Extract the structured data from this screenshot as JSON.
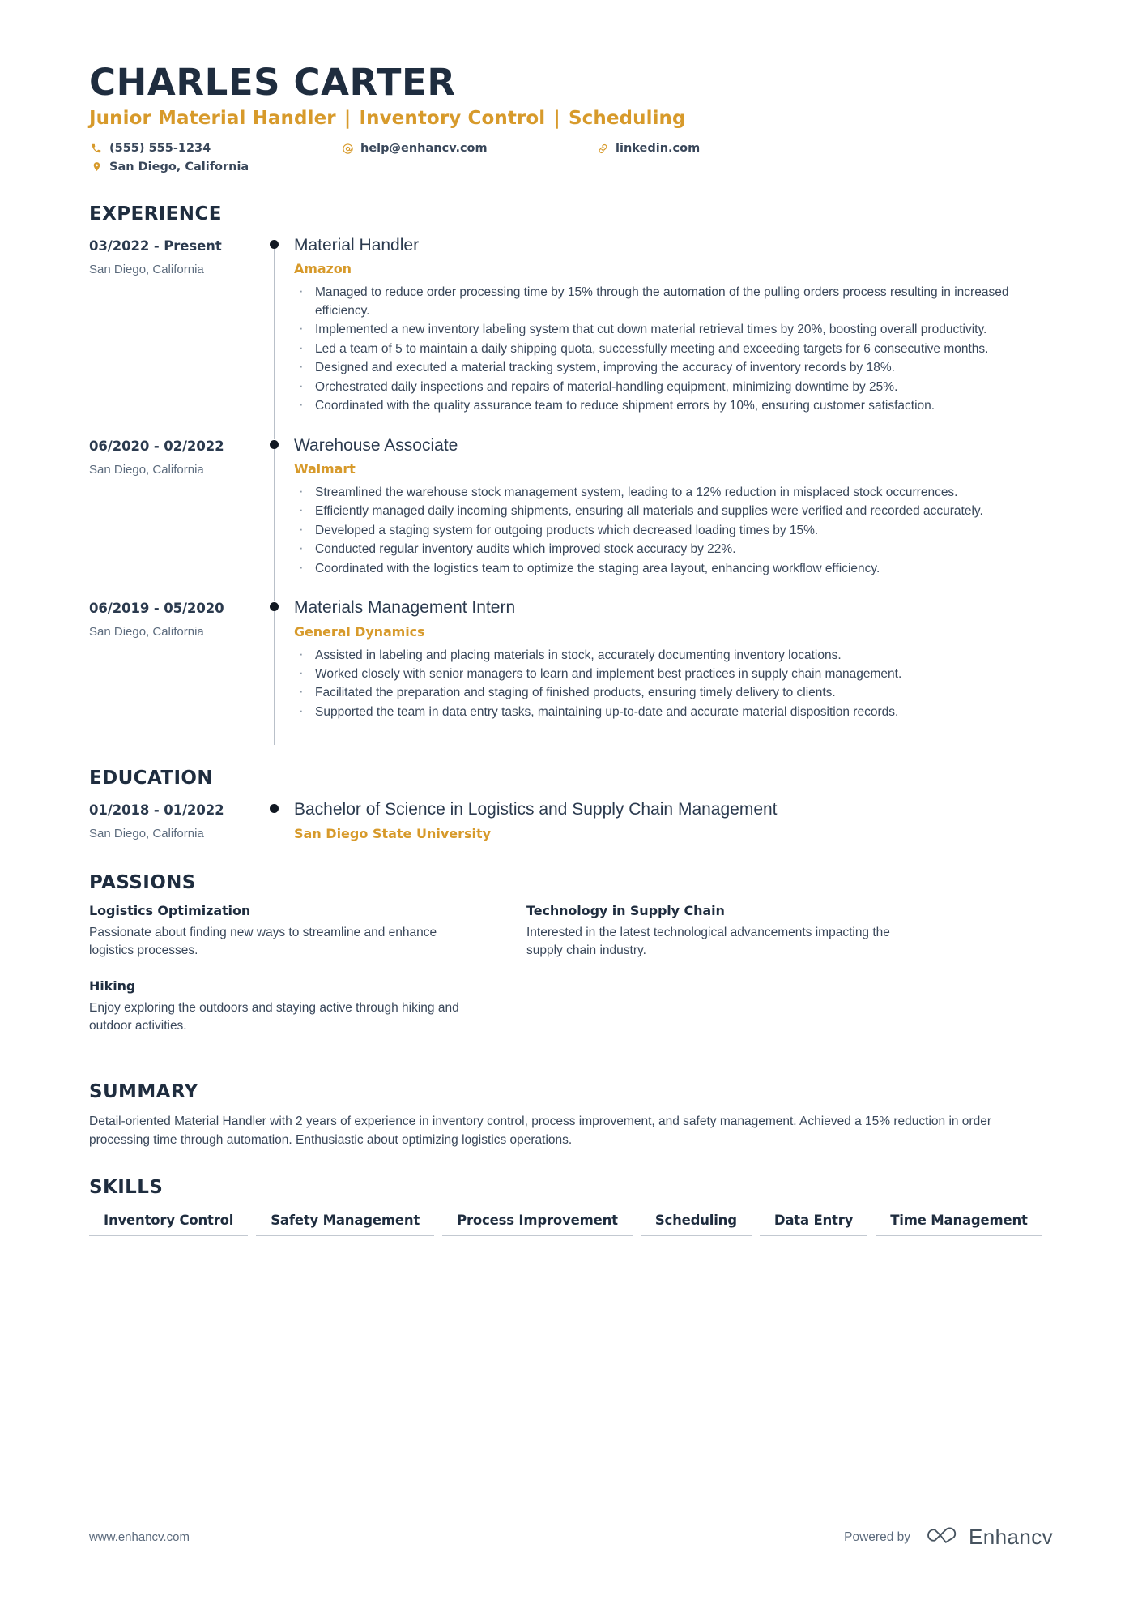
{
  "header": {
    "name": "CHARLES CARTER",
    "headline_parts": [
      "Junior Material Handler",
      "Inventory Control",
      "Scheduling"
    ],
    "headline": "Junior Material Handler | Inventory Control | Scheduling",
    "contacts": [
      {
        "icon": "phone-icon",
        "label": "(555) 555-1234"
      },
      {
        "icon": "email-icon",
        "label": "help@enhancv.com"
      },
      {
        "icon": "link-icon",
        "label": "linkedin.com"
      },
      {
        "icon": "location-pin-icon",
        "label": "San Diego, California"
      }
    ]
  },
  "sections": {
    "experience_title": "EXPERIENCE",
    "education_title": "EDUCATION",
    "passions_title": "PASSIONS",
    "summary_title": "SUMMARY",
    "skills_title": "SKILLS"
  },
  "experience": [
    {
      "date": "03/2022 - Present",
      "location": "San Diego, California",
      "title": "Material Handler",
      "company": "Amazon",
      "bullets": [
        "Managed to reduce order processing time by 15% through the automation of the pulling orders process resulting in increased efficiency.",
        "Implemented a new inventory labeling system that cut down material retrieval times by 20%, boosting overall productivity.",
        "Led a team of 5 to maintain a daily shipping quota, successfully meeting and exceeding targets for 6 consecutive months.",
        "Designed and executed a material tracking system, improving the accuracy of inventory records by 18%.",
        "Orchestrated daily inspections and repairs of material-handling equipment, minimizing downtime by 25%.",
        "Coordinated with the quality assurance team to reduce shipment errors by 10%, ensuring customer satisfaction."
      ]
    },
    {
      "date": "06/2020 - 02/2022",
      "location": "San Diego, California",
      "title": "Warehouse Associate",
      "company": "Walmart",
      "bullets": [
        "Streamlined the warehouse stock management system, leading to a 12% reduction in misplaced stock occurrences.",
        "Efficiently managed daily incoming shipments, ensuring all materials and supplies were verified and recorded accurately.",
        "Developed a staging system for outgoing products which decreased loading times by 15%.",
        "Conducted regular inventory audits which improved stock accuracy by 22%.",
        "Coordinated with the logistics team to optimize the staging area layout, enhancing workflow efficiency."
      ]
    },
    {
      "date": "06/2019 - 05/2020",
      "location": "San Diego, California",
      "title": "Materials Management Intern",
      "company": "General Dynamics",
      "bullets": [
        "Assisted in labeling and placing materials in stock, accurately documenting inventory locations.",
        "Worked closely with senior managers to learn and implement best practices in supply chain management.",
        "Facilitated the preparation and staging of finished products, ensuring timely delivery to clients.",
        "Supported the team in data entry tasks, maintaining up-to-date and accurate material disposition records."
      ]
    }
  ],
  "education": [
    {
      "date": "01/2018 - 01/2022",
      "location": "San Diego, California",
      "degree": "Bachelor of Science in Logistics and Supply Chain Management",
      "school": "San Diego State University"
    }
  ],
  "passions": [
    {
      "title": "Logistics Optimization",
      "description": "Passionate about finding new ways to streamline and enhance logistics processes."
    },
    {
      "title": "Technology in Supply Chain",
      "description": "Interested in the latest technological advancements impacting the supply chain industry."
    },
    {
      "title": "Hiking",
      "description": "Enjoy exploring the outdoors and staying active through hiking and outdoor activities."
    }
  ],
  "summary": "Detail-oriented Material Handler with 2 years of experience in inventory control, process improvement, and safety management. Achieved a 15% reduction in order processing time through automation. Enthusiastic about optimizing logistics operations.",
  "skills": [
    "Inventory Control",
    "Safety Management",
    "Process Improvement",
    "Scheduling",
    "Data Entry",
    "Time Management"
  ],
  "footer": {
    "url": "www.enhancv.com",
    "powered_by": "Powered by",
    "brand": "Enhancv"
  },
  "colors": {
    "accent": "#d79a2b",
    "heading": "#1f2d3f",
    "body": "#39475a",
    "muted": "#5c6b7d",
    "rule": "#c3c9d1"
  }
}
